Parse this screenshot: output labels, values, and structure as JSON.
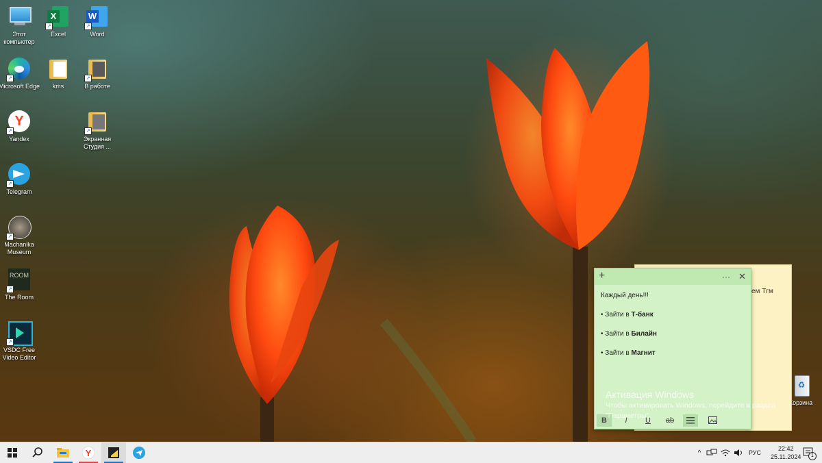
{
  "desktop": {
    "icons": [
      {
        "name": "this-pc",
        "label": "Этот компьютер"
      },
      {
        "name": "excel",
        "label": "Excel"
      },
      {
        "name": "word",
        "label": "Word"
      },
      {
        "name": "microsoft-edge",
        "label": "Microsoft Edge"
      },
      {
        "name": "kms",
        "label": "kms"
      },
      {
        "name": "v-rabote",
        "label": "В работе"
      },
      {
        "name": "yandex",
        "label": "Yandex"
      },
      {
        "name": "ekrannaya-studiya",
        "label": "Экранная Студия ..."
      },
      {
        "name": "telegram",
        "label": "Telegram"
      },
      {
        "name": "machanika-museum",
        "label": "Machanika Museum"
      },
      {
        "name": "the-room",
        "label": "The Room"
      },
      {
        "name": "vsdc",
        "label": "VSDC Free Video Editor"
      },
      {
        "name": "recycle-bin",
        "label": "Корзина"
      }
    ]
  },
  "sticky_back": {
    "partial_text": "ем Тгм"
  },
  "sticky_note": {
    "title_icons": {
      "add": "+",
      "menu": "···",
      "close": "✕"
    },
    "heading": "Каждый день!!!",
    "items": [
      {
        "prefix": "• Зайти в ",
        "bold": "Т-банк"
      },
      {
        "prefix": "• Зайти в ",
        "bold": "Билайн"
      },
      {
        "prefix": "• Зайти в ",
        "bold": "Магнит"
      }
    ],
    "toolbar": {
      "bold": "B",
      "italic": "I",
      "underline": "U",
      "strike": "ab"
    }
  },
  "activation": {
    "title": "Активация Windows",
    "line1": "Чтобы активировать Windows, перейдите в раздел",
    "line2": "\"Параметры\"."
  },
  "taskbar": {
    "language": "РУС",
    "time": "22:42",
    "date": "25.11.2024",
    "notification_count": "1",
    "colors": {
      "yandex": "#fc3f1d",
      "telegram": "#2aa3e0",
      "sticky": "#f5d142"
    }
  }
}
